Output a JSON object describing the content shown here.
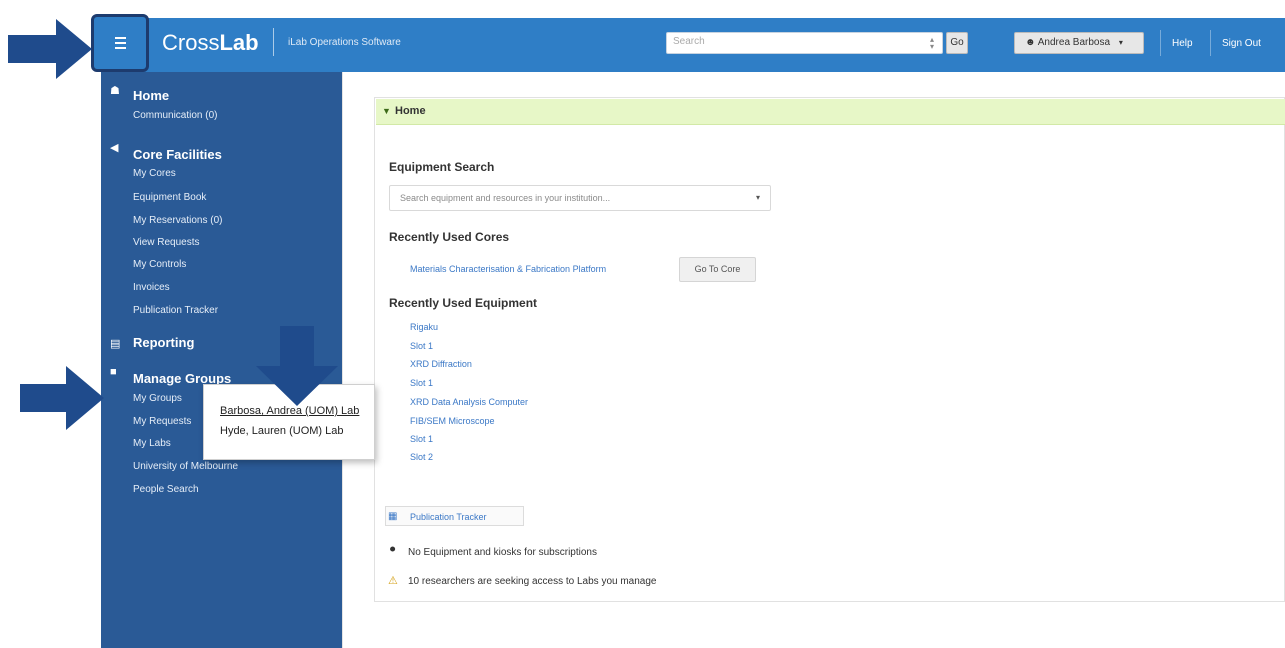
{
  "header": {
    "logo_text_a": "Cross",
    "logo_text_b": "Lab",
    "app_subtitle": "iLab Operations Software",
    "search_placeholder": "Search",
    "go_label": "Go",
    "user_label": "Andrea Barbosa",
    "help_label": "Help",
    "signout_label": "Sign Out"
  },
  "sidebar": {
    "home": {
      "title": "Home",
      "links": [
        "Communication (0)"
      ]
    },
    "core": {
      "title": "Core Facilities",
      "links": [
        "My Cores",
        "Equipment Book",
        "My Reservations (0)",
        "View Requests",
        "My Controls",
        "Invoices",
        "Publication Tracker"
      ]
    },
    "reporting": {
      "title": "Reporting"
    },
    "manage": {
      "title": "Manage Groups",
      "links": [
        "My Groups",
        "My Requests",
        "My Labs",
        "University of Melbourne",
        "People Search"
      ]
    }
  },
  "popup": {
    "items": [
      "Barbosa, Andrea (UOM) Lab",
      "Hyde, Lauren (UOM) Lab"
    ]
  },
  "main": {
    "panel_title": "Home",
    "equipment_search_label": "Equipment Search",
    "equipment_search_placeholder": "Search equipment and resources in your institution...",
    "recent_cores_label": "Recently Used Cores",
    "recent_core_link": "Materials Characterisation & Fabrication Platform",
    "recent_core_button": "Go To Core",
    "recent_equipment_label": "Recently Used Equipment",
    "recent_equipment": [
      "Rigaku",
      "Slot 1",
      "XRD Diffraction",
      "Slot 1",
      "XRD Data Analysis Computer",
      "FIB/SEM Microscope",
      "Slot 1",
      "Slot 2"
    ],
    "pub_link": "Publication Tracker",
    "note1": "No Equipment and kiosks for subscriptions",
    "note2": "10 researchers are seeking access to Labs you manage"
  },
  "colors": {
    "topbar": "#2f7ec6",
    "sidebar": "#2a5a96",
    "panel_header": "#e7f7c7",
    "link": "#3b78c6",
    "arrow": "#1f4b8c"
  }
}
